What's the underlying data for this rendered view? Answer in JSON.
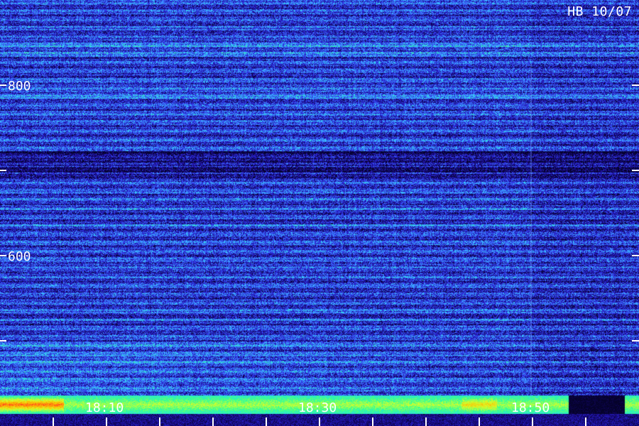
{
  "chart_data": {
    "type": "heatmap",
    "title": "",
    "station_date_label": "HB 10/07",
    "xlabel": "",
    "ylabel": "",
    "y_tick_labels": [
      "800",
      "600"
    ],
    "y_ticks": [
      800,
      600
    ],
    "y_minor_ticks": [
      700,
      500
    ],
    "ylim": [
      400,
      900
    ],
    "x_tick_labels": [
      "18:10",
      "18:30",
      "18:50"
    ],
    "x_time_range_minutes": [
      "18:00",
      "19:00"
    ],
    "x_major_ticks_minutes": [
      10,
      30,
      50
    ],
    "x_minor_tick_interval_minutes": 2.5,
    "intensity_description": "noise with horizontal banding; strong low-frequency band along bottom edge",
    "colormap": [
      "#05022a",
      "#1a0a8a",
      "#2d2ce0",
      "#3f7cff",
      "#37d0ff",
      "#2cff9a",
      "#d6ff2a",
      "#ffb400",
      "#ff2a2a"
    ],
    "axis_color": "#ffffff"
  }
}
